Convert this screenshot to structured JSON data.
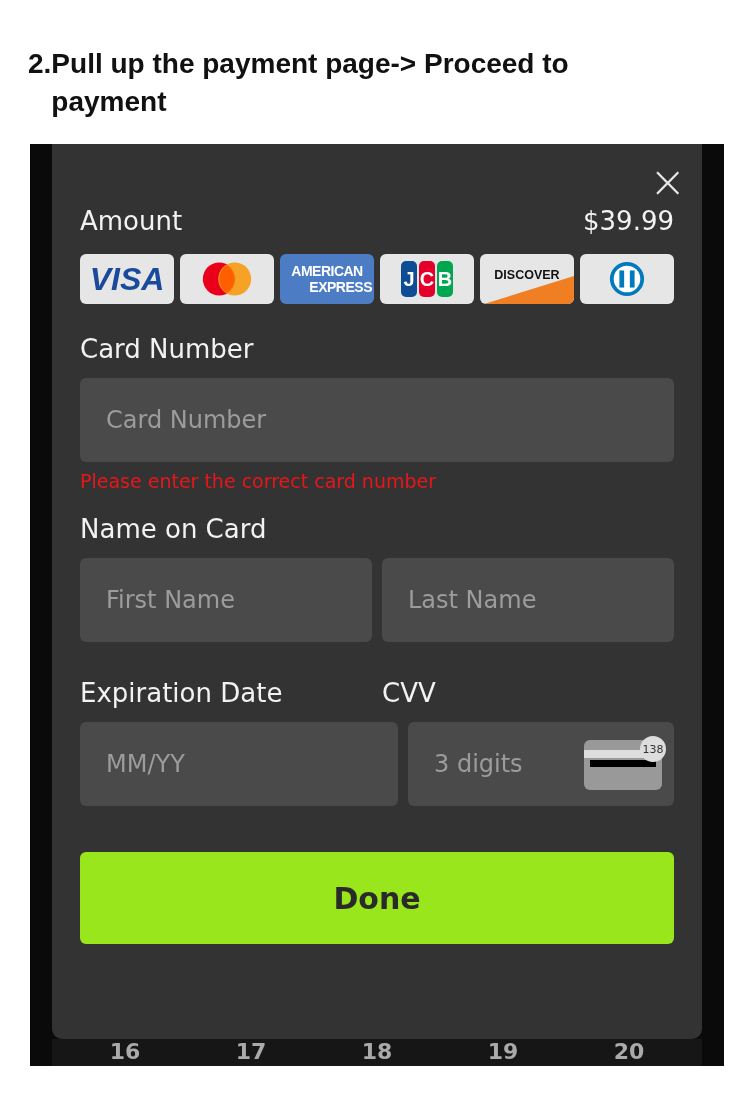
{
  "heading": {
    "number": "2.",
    "text": "Pull up the payment page-> Proceed to payment"
  },
  "modal": {
    "close": "×",
    "amount_label": "Amount",
    "amount": "$39.99",
    "cards": [
      {
        "kind": "visa",
        "lines": [
          "VISA"
        ]
      },
      {
        "kind": "mastercard"
      },
      {
        "kind": "amex",
        "lines": [
          "AMERICAN",
          "EXPRESS"
        ]
      },
      {
        "kind": "jcb",
        "lines": [
          "JCB"
        ]
      },
      {
        "kind": "discover",
        "lines": [
          "DISCOVER"
        ]
      },
      {
        "kind": "diners"
      }
    ],
    "card_number": {
      "label": "Card Number",
      "placeholder": "Card Number",
      "error": "Please enter the correct card number"
    },
    "name": {
      "label": "Name on Card",
      "first_placeholder": "First Name",
      "last_placeholder": "Last Name"
    },
    "expiration": {
      "label": "Expiration Date",
      "placeholder": "MM/YY"
    },
    "cvv": {
      "label": "CVV",
      "placeholder": "3 digits",
      "hint": "138"
    },
    "done": "Done"
  },
  "background_dates": [
    "16",
    "17",
    "18",
    "19",
    "20"
  ]
}
